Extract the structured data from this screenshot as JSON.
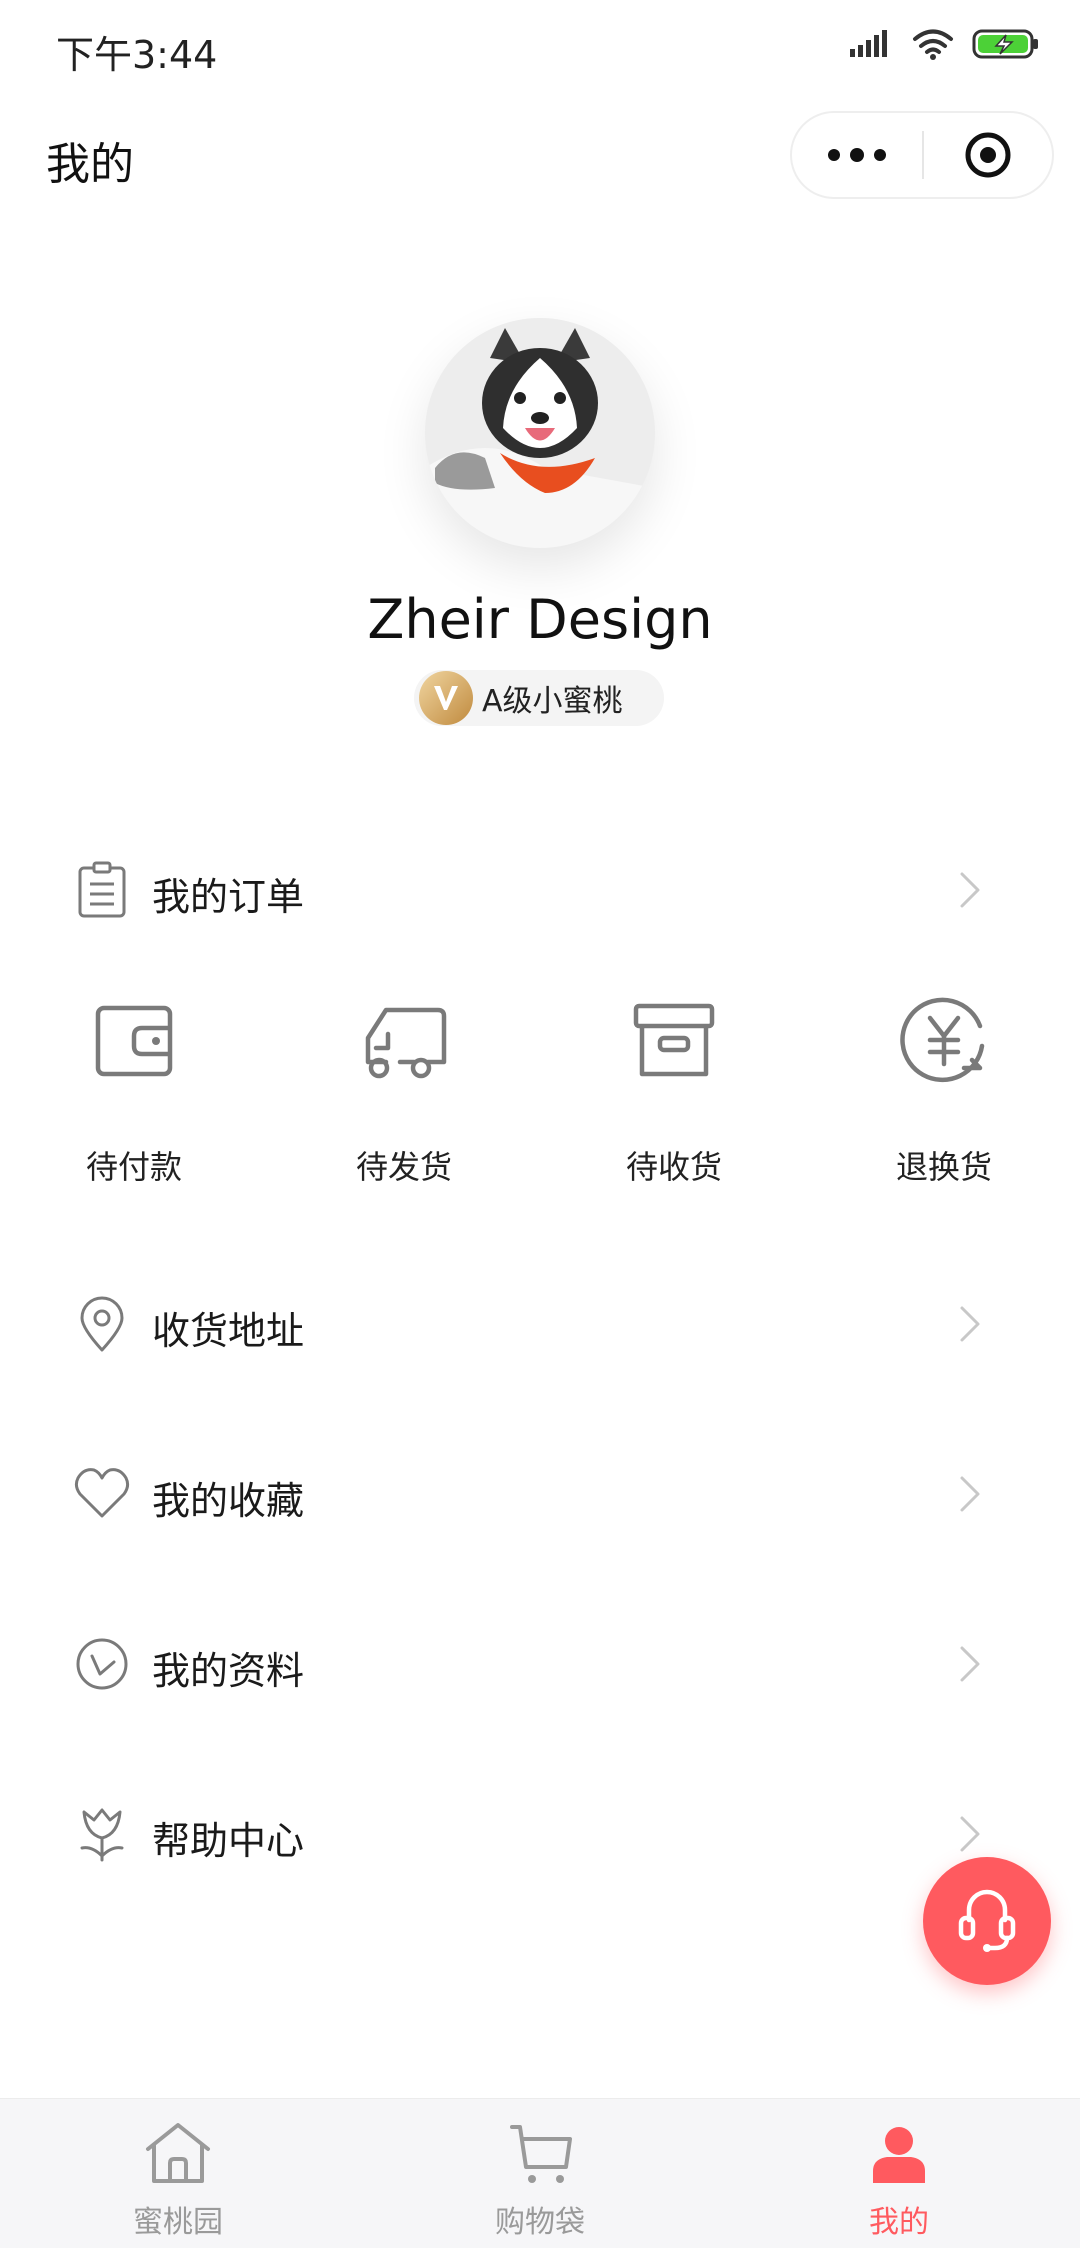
{
  "status_bar": {
    "time": "下午3:44"
  },
  "nav": {
    "title": "我的"
  },
  "profile": {
    "name": "Zheir Design",
    "level_badge": "A级小蜜桃"
  },
  "menu": {
    "orders": "我的订单",
    "address": "收货地址",
    "favorites": "我的收藏",
    "profile_info": "我的资料",
    "help_center": "帮助中心"
  },
  "order_status": [
    {
      "label": "待付款",
      "icon": "wallet-icon"
    },
    {
      "label": "待发货",
      "icon": "delivery-truck-icon"
    },
    {
      "label": "待收货",
      "icon": "package-box-icon"
    },
    {
      "label": "退换货",
      "icon": "yuan-refund-icon"
    }
  ],
  "tabbar": {
    "items": [
      {
        "label": "蜜桃园",
        "icon": "home-icon"
      },
      {
        "label": "购物袋",
        "icon": "cart-icon"
      },
      {
        "label": "我的",
        "icon": "user-icon"
      }
    ],
    "active_index": 2
  },
  "colors": {
    "accent": "#ff5a5f",
    "icon_gray": "#7a7a7a",
    "chevron_gray": "#c8c8c8",
    "tabbar_bg": "#f6f6f8",
    "battery_green": "#4cd137",
    "badge_gold": "#d4a55a"
  }
}
